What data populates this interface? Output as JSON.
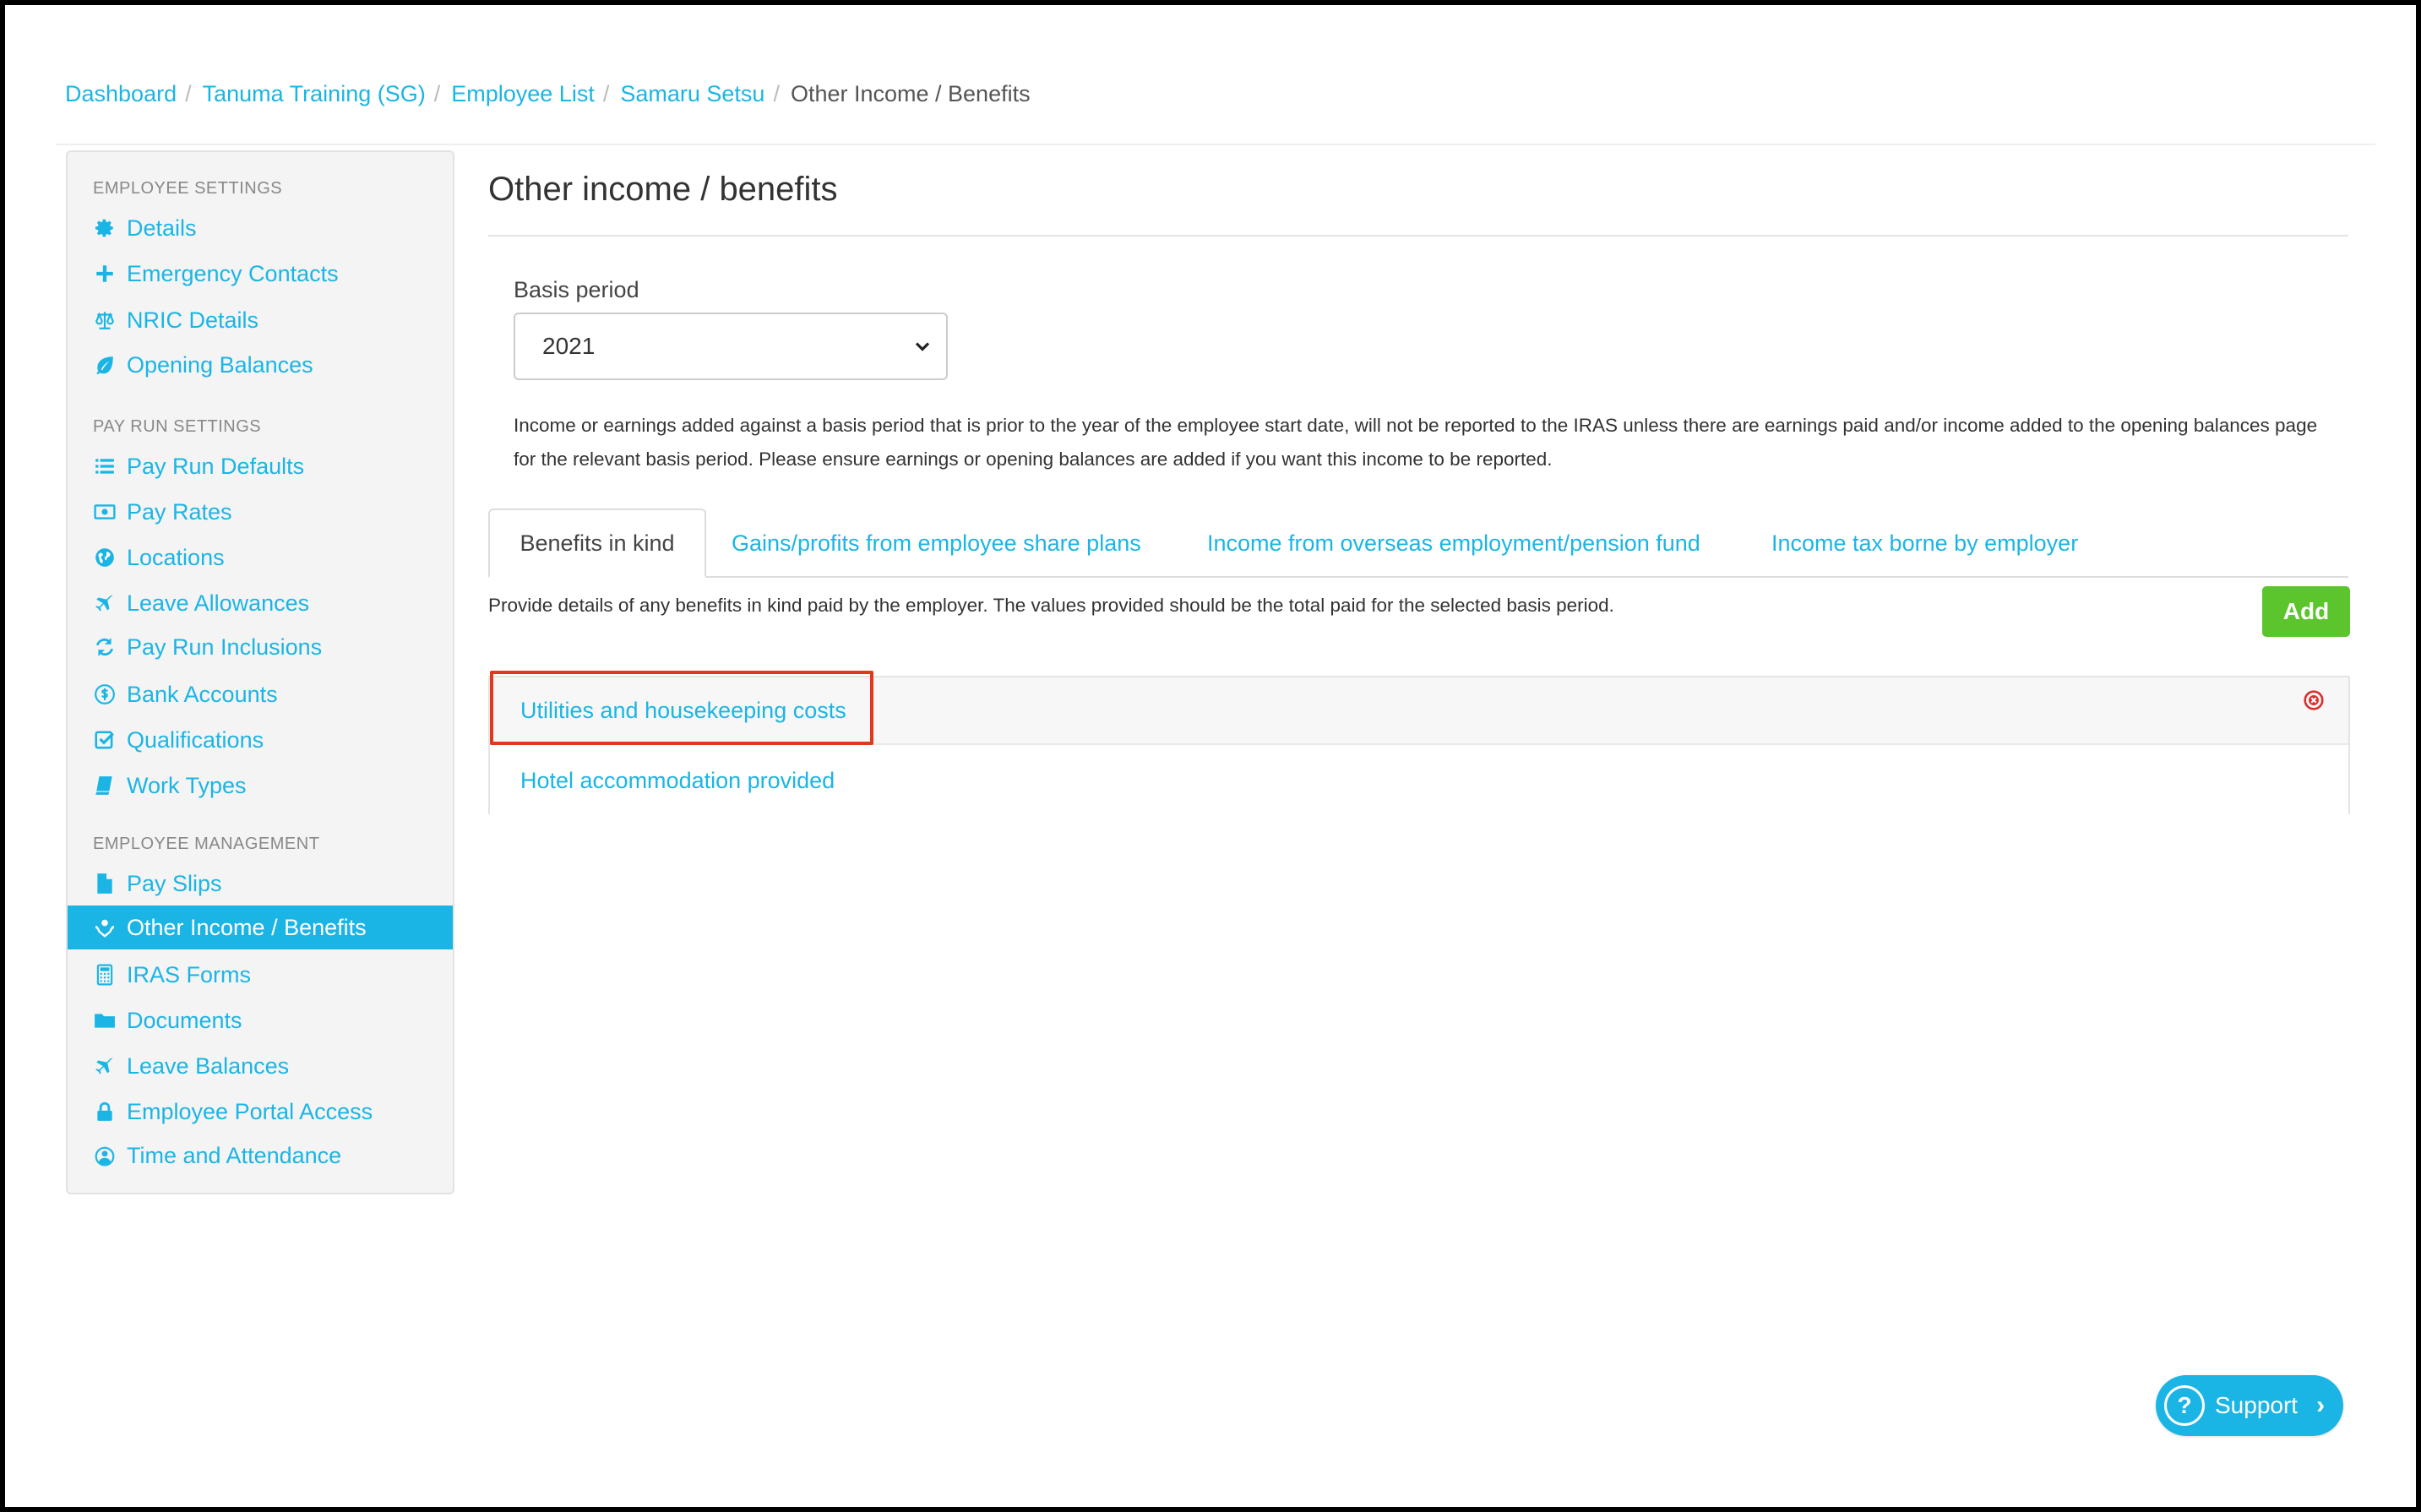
{
  "breadcrumb": {
    "items": [
      "Dashboard",
      "Tanuma Training (SG)",
      "Employee List",
      "Samaru Setsu"
    ],
    "current": "Other Income / Benefits"
  },
  "sidebar": {
    "sections": [
      "EMPLOYEE SETTINGS",
      "PAY RUN SETTINGS",
      "EMPLOYEE MANAGEMENT"
    ],
    "items": [
      {
        "label": "Details",
        "icon": "gear-icon"
      },
      {
        "label": "Emergency Contacts",
        "icon": "plus-icon"
      },
      {
        "label": "NRIC Details",
        "icon": "scales-icon"
      },
      {
        "label": "Opening Balances",
        "icon": "leaf-icon"
      },
      {
        "label": "Pay Run Defaults",
        "icon": "list-icon"
      },
      {
        "label": "Pay Rates",
        "icon": "money-icon"
      },
      {
        "label": "Locations",
        "icon": "globe-icon"
      },
      {
        "label": "Leave Allowances",
        "icon": "plane-icon"
      },
      {
        "label": "Pay Run Inclusions",
        "icon": "refresh-icon"
      },
      {
        "label": "Bank Accounts",
        "icon": "dollar-circle-icon"
      },
      {
        "label": "Qualifications",
        "icon": "check-square-icon"
      },
      {
        "label": "Work Types",
        "icon": "book-icon"
      },
      {
        "label": "Pay Slips",
        "icon": "file-icon"
      },
      {
        "label": "Other Income / Benefits",
        "icon": "hand-holding-icon"
      },
      {
        "label": "IRAS Forms",
        "icon": "calculator-icon"
      },
      {
        "label": "Documents",
        "icon": "folder-icon"
      },
      {
        "label": "Leave Balances",
        "icon": "plane-icon"
      },
      {
        "label": "Employee Portal Access",
        "icon": "lock-icon"
      },
      {
        "label": "Time and Attendance",
        "icon": "user-clock-icon"
      }
    ]
  },
  "main": {
    "title": "Other income / benefits",
    "basis_label": "Basis period",
    "basis_value": "2021",
    "info_text": "Income or earnings added against a basis period that is prior to the year of the employee start date, will not be reported to the IRAS unless there are earnings paid and/or income added to the opening balances page for the relevant basis period. Please ensure earnings or opening balances are added if you want this income to be reported.",
    "tabs": [
      "Benefits in kind",
      "Gains/profits from employee share plans",
      "Income from overseas employment/pension fund",
      "Income tax borne by employer"
    ],
    "tab_description": "Provide details of any benefits in kind paid by the employer. The values provided should be the total paid for the selected basis period.",
    "add_label": "Add",
    "rows": [
      "Utilities and housekeeping costs",
      "Hotel accommodation provided"
    ]
  },
  "support": {
    "label": "Support",
    "q": "?",
    "chevron": "›"
  },
  "colors": {
    "accent": "#1bb5e5",
    "add_button": "#5cc52e",
    "highlight": "#e0391b",
    "remove": "#d9302c"
  }
}
